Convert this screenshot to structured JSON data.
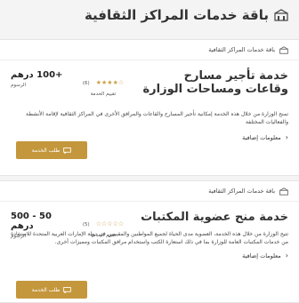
{
  "page": {
    "title": "باقة خدمات المراكز الثقافية"
  },
  "colors": {
    "accent": "#c4973c",
    "star": "#c9a049",
    "background": "#f4f4f4"
  },
  "cards": [
    {
      "category": "باقة خدمات المراكز الثقافية",
      "title": "خدمة تأجير مسارح وقاعات ومساحات الوزارة",
      "stars": "★★★★☆",
      "rating_count": "(6)",
      "rating_label": "تقييم الخدمة",
      "price": "+100 درهم",
      "price_label": "الرسوم",
      "description": "تمنح الوزارة من خلال هذه الخدمة إمكانية تأجير المسارح والقاعات والمرافق الأخرى في المراكز الثقافية لإقامة الأنشطة والفعاليات المختلفة",
      "more_info": "معلومات إضافية",
      "button_label": "طلب الخدمة"
    },
    {
      "category": "باقة خدمات المراكز الثقافية",
      "title": "خدمة منح عضوية المكتبات",
      "stars": "☆☆☆☆☆",
      "rating_count": "(5)",
      "rating_label": "تقييم الخدمة",
      "price": "50 - 500 درهم",
      "price_label": "الرسوم",
      "description": "تتيح الوزارة من خلال هذه الخدمة، العضوية مدى الحياة لجميع المواطنين والمقيمين في دولة الإمارات العربية المتحدة للاستفادة من خدمات المكتبات العامة للوزارة بما في ذلك استعارة الكتب واستخدام مرافق المكتبات ومميزات أخرى.",
      "more_info": "معلومات إضافية",
      "button_label": "طلب الخدمة"
    }
  ]
}
